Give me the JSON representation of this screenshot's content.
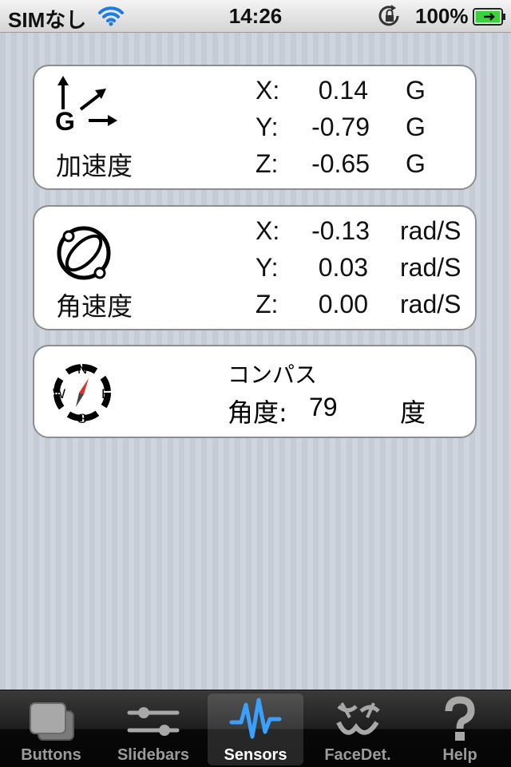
{
  "status_bar": {
    "carrier": "SIMなし",
    "time": "14:26",
    "battery": "100%"
  },
  "accelerometer": {
    "label": "加速度",
    "icon_letter": "G",
    "rows": [
      {
        "axis": "X:",
        "value": "0.14",
        "unit": "G"
      },
      {
        "axis": "Y:",
        "value": "-0.79",
        "unit": "G"
      },
      {
        "axis": "Z:",
        "value": "-0.65",
        "unit": "G"
      }
    ]
  },
  "gyroscope": {
    "label": "角速度",
    "rows": [
      {
        "axis": "X:",
        "value": "-0.13",
        "unit": "rad/S"
      },
      {
        "axis": "Y:",
        "value": "0.03",
        "unit": "rad/S"
      },
      {
        "axis": "Z:",
        "value": "0.00",
        "unit": "rad/S"
      }
    ]
  },
  "compass": {
    "title": "コンパス",
    "angle_label": "角度:",
    "angle_value": "79",
    "angle_unit": "度",
    "directions": {
      "n": "N",
      "e": "E",
      "s": "S",
      "w": "W"
    }
  },
  "tabs": [
    {
      "label": "Buttons",
      "icon": "buttons-icon",
      "active": false
    },
    {
      "label": "Slidebars",
      "icon": "slidebars-icon",
      "active": false
    },
    {
      "label": "Sensors",
      "icon": "sensors-icon",
      "active": true
    },
    {
      "label": "FaceDet.",
      "icon": "face-detection-icon",
      "active": false
    },
    {
      "label": "Help",
      "icon": "help-icon",
      "active": false
    }
  ],
  "colors": {
    "active_tab_icon": "#3aa0ff",
    "battery_fill": "#3cd23c"
  }
}
